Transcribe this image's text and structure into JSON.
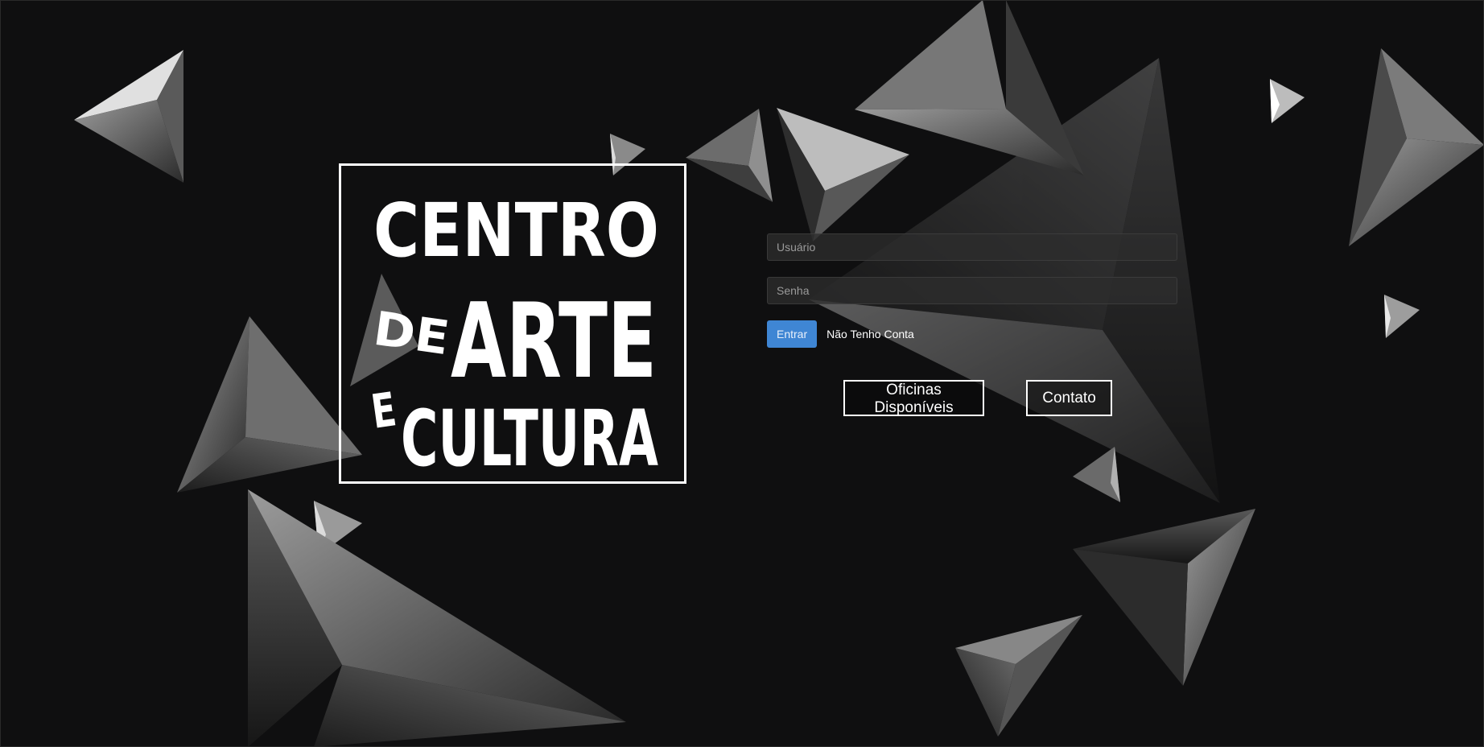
{
  "logo": {
    "line1": "CENTRO",
    "line2_small": "DE",
    "line2_big": "ARTE",
    "line3_small": "E",
    "line3_big": "CULTURA"
  },
  "login": {
    "username_placeholder": "Usuário",
    "password_placeholder": "Senha",
    "submit_label": "Entrar",
    "no_account_label": "Não Tenho Conta"
  },
  "nav": {
    "workshops_label": "Oficinas Disponíveis",
    "contact_label": "Contato"
  },
  "colors": {
    "background": "#0f0f10",
    "accent": "#3f86d4",
    "foreground": "#ffffff"
  }
}
